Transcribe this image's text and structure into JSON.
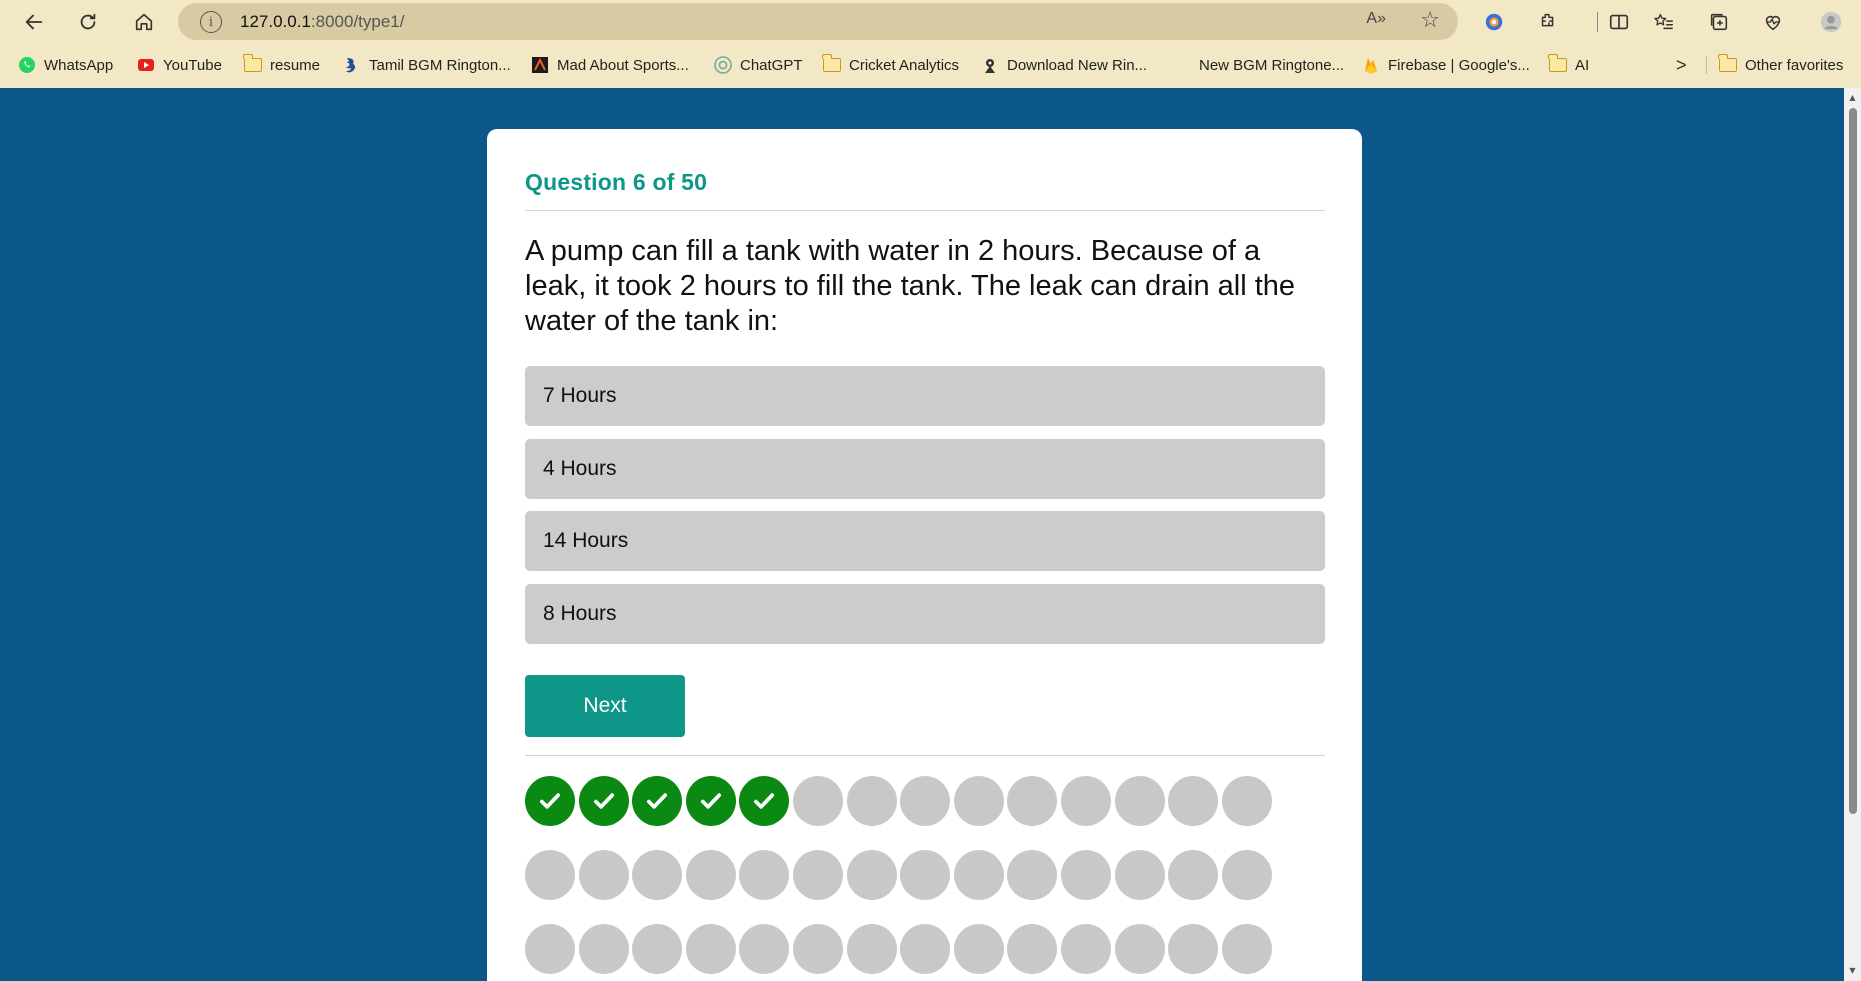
{
  "browser": {
    "url_host": "127.0.0.1",
    "url_path": ":8000/type1/",
    "read_aloud": "A»",
    "bookmarks": [
      {
        "label": "WhatsApp",
        "icon": "whatsapp-icon",
        "color": "#25d366"
      },
      {
        "label": "YouTube",
        "icon": "youtube-icon",
        "color": "#e62117"
      },
      {
        "label": "resume",
        "icon": "folder-icon"
      },
      {
        "label": "Tamil BGM Rington...",
        "icon": "site-icon",
        "color": "#1f4f9a"
      },
      {
        "label": "Mad About Sports...",
        "icon": "site-icon",
        "color": "#1a1a1a"
      },
      {
        "label": "ChatGPT",
        "icon": "chatgpt-icon",
        "color": "#74aa9c"
      },
      {
        "label": "Cricket Analytics",
        "icon": "folder-icon"
      },
      {
        "label": "Download New Rin...",
        "icon": "site-icon",
        "color": "#333333"
      },
      {
        "label": "New BGM Ringtone...",
        "icon": "none"
      },
      {
        "label": "Firebase | Google's...",
        "icon": "firebase-icon",
        "color": "#ffa000"
      },
      {
        "label": "AI",
        "icon": "folder-icon"
      },
      {
        "label": "Other favorites",
        "icon": "folder-icon"
      }
    ]
  },
  "quiz": {
    "header": "Question 6 of 50",
    "question": "A pump can fill a tank with water in 2 hours. Because of a leak, it took 2 hours to fill the tank. The leak can drain all the water of the tank in:",
    "options": [
      "7 Hours",
      "4 Hours",
      "14 Hours",
      "8 Hours"
    ],
    "next_label": "Next",
    "total_questions": 50,
    "answered_count": 5,
    "progress_colors": {
      "done": "#0a8a12",
      "pending": "#c8c8c8",
      "accent": "#0e9688"
    }
  }
}
